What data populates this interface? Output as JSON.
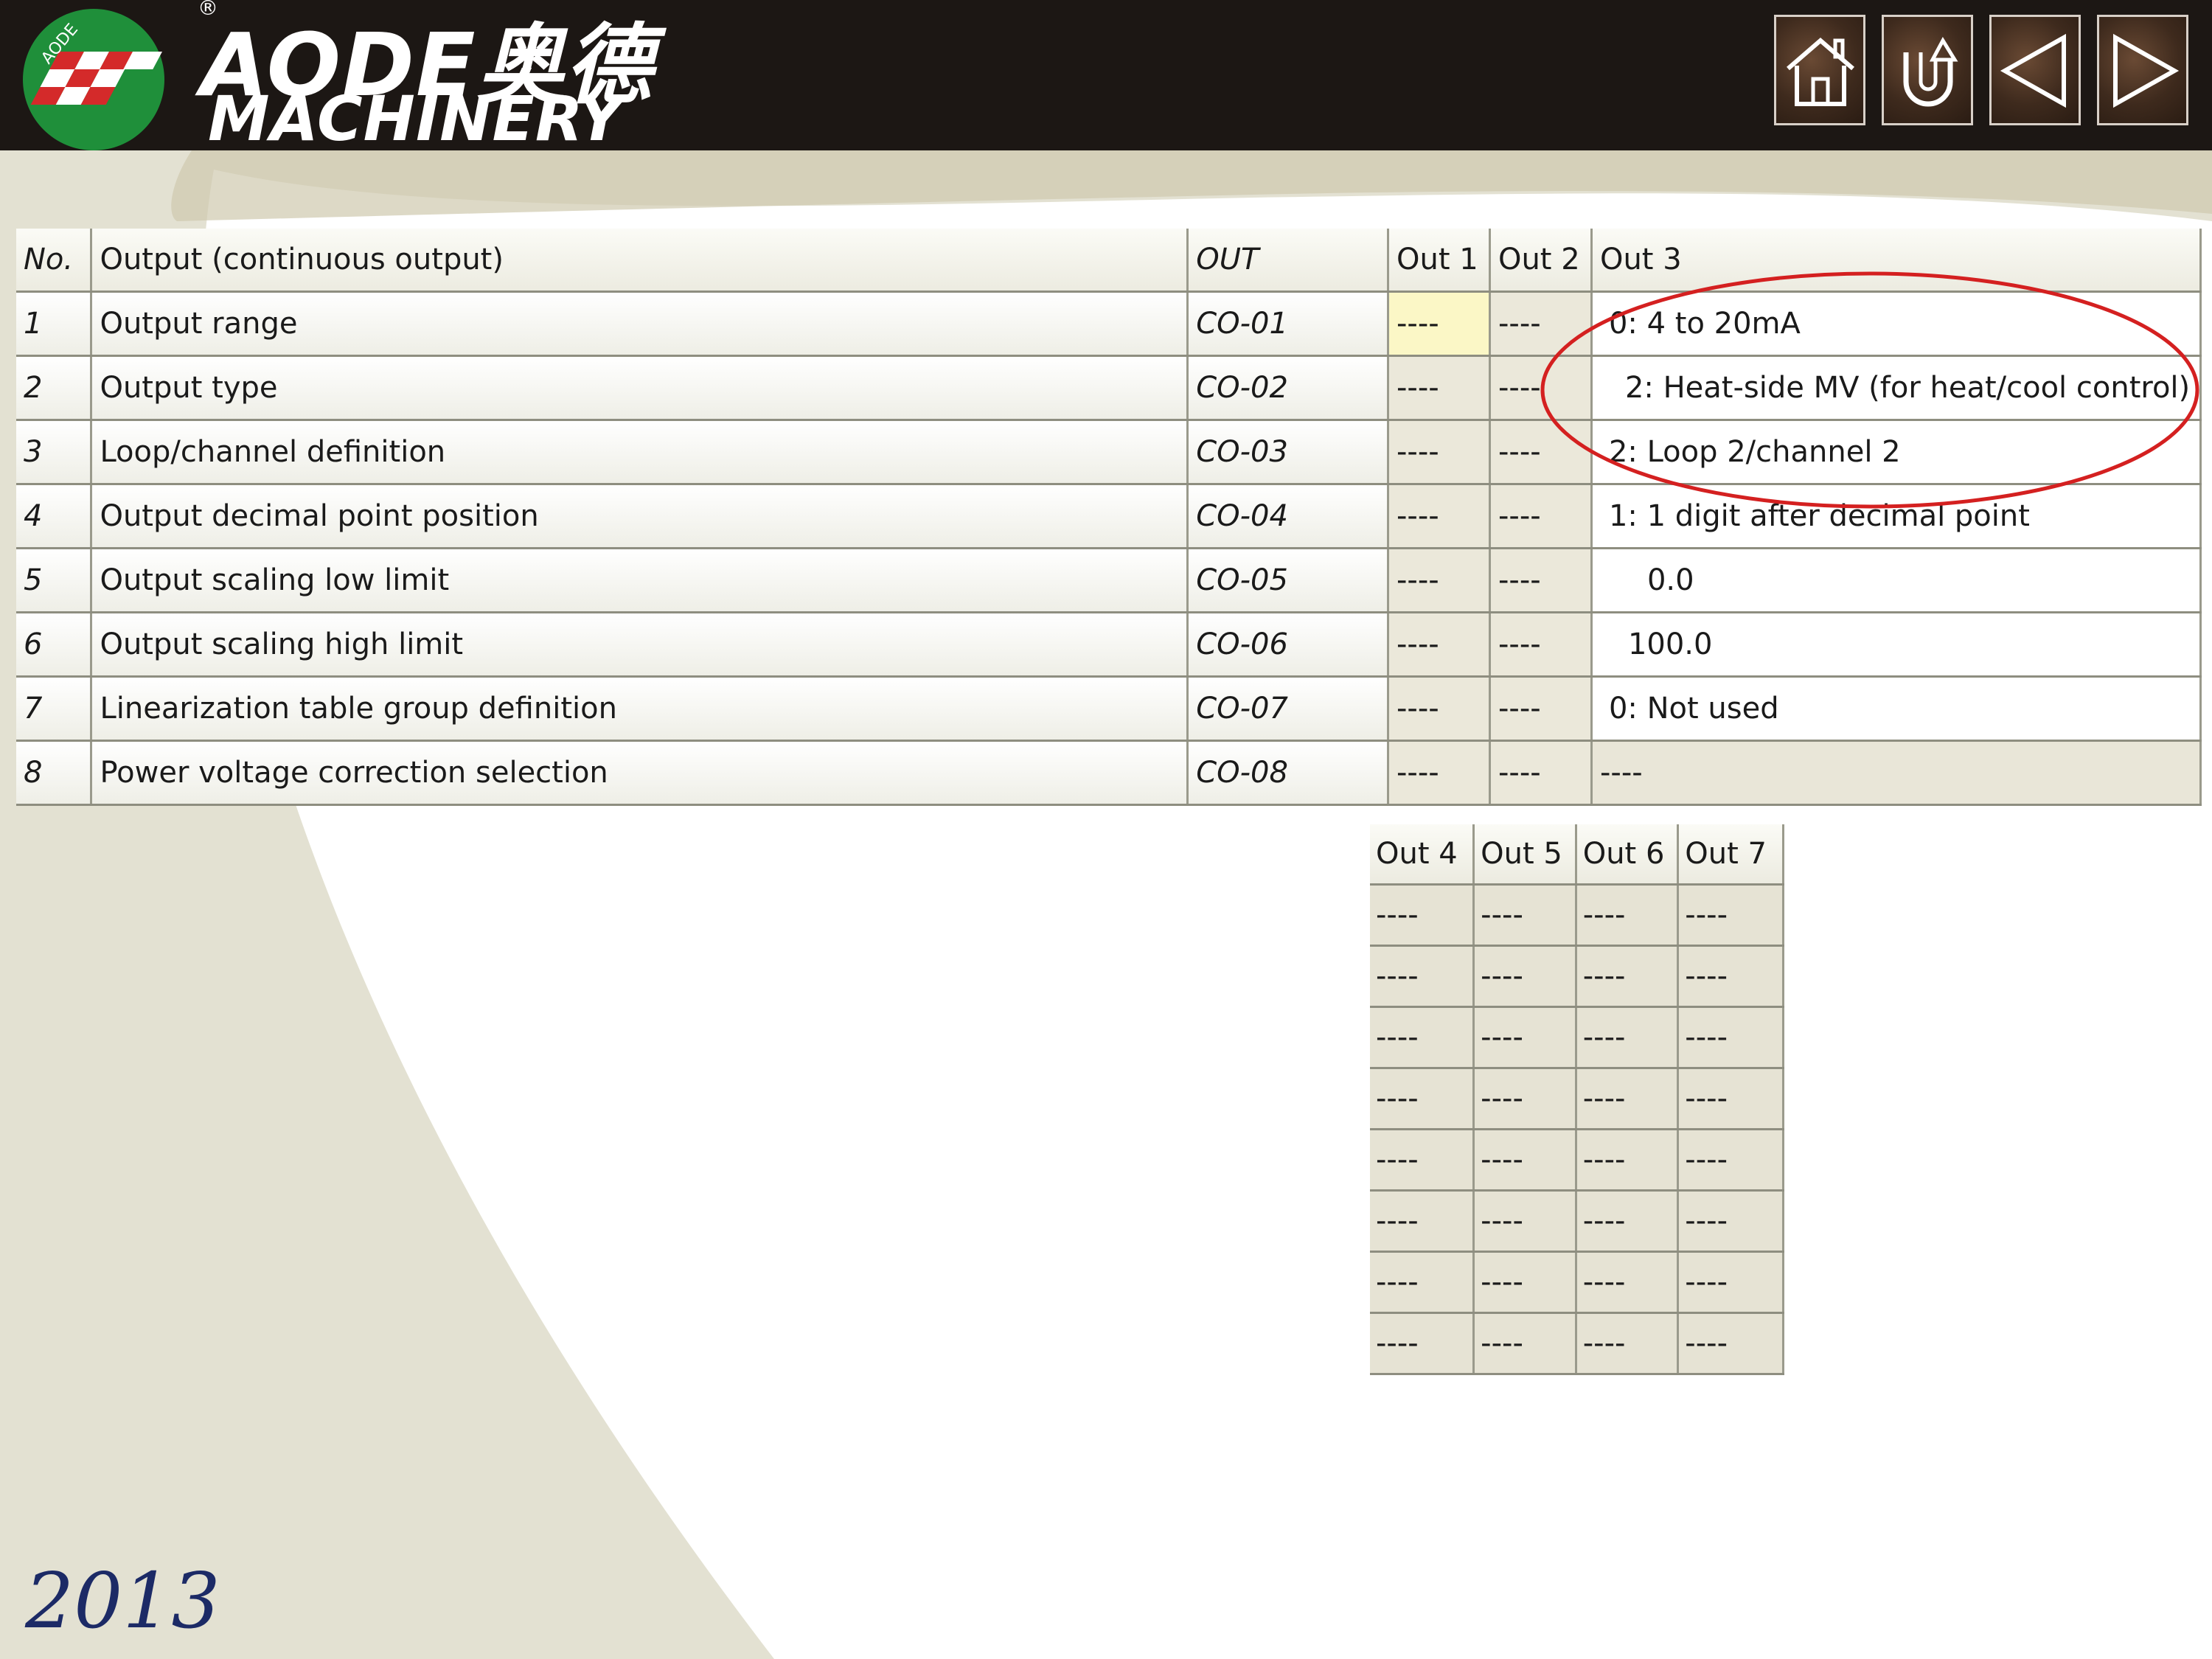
{
  "header": {
    "brand_line1": "AODE奥德",
    "brand_line2": "MACHINERY",
    "logo_text": "AODE",
    "registered_mark": "®"
  },
  "nav": {
    "home_icon": "home-icon",
    "back_icon": "return-icon",
    "prev_icon": "prev-arrow-icon",
    "next_icon": "next-arrow-icon"
  },
  "main_table": {
    "headers": [
      "No.",
      "Output (continuous output)",
      "OUT",
      "Out 1",
      "Out 2",
      "Out 3"
    ],
    "rows": [
      {
        "no": "1",
        "name": "Output range",
        "code": "CO-01",
        "out1": "----",
        "out2": "----",
        "out3": "0: 4 to 20mA"
      },
      {
        "no": "2",
        "name": "Output type",
        "code": "CO-02",
        "out1": "----",
        "out2": "----",
        "out3": "2: Heat-side MV (for heat/cool control)"
      },
      {
        "no": "3",
        "name": "Loop/channel definition",
        "code": "CO-03",
        "out1": "----",
        "out2": "----",
        "out3": "2: Loop 2/channel 2"
      },
      {
        "no": "4",
        "name": "Output decimal point position",
        "code": "CO-04",
        "out1": "----",
        "out2": "----",
        "out3": "1: 1 digit after decimal point"
      },
      {
        "no": "5",
        "name": "Output scaling low limit",
        "code": "CO-05",
        "out1": "----",
        "out2": "----",
        "out3": "0.0"
      },
      {
        "no": "6",
        "name": "Output scaling high limit",
        "code": "CO-06",
        "out1": "----",
        "out2": "----",
        "out3": "100.0"
      },
      {
        "no": "7",
        "name": "Linearization table group definition",
        "code": "CO-07",
        "out1": "----",
        "out2": "----",
        "out3": "0: Not used"
      },
      {
        "no": "8",
        "name": "Power voltage correction selection",
        "code": "CO-08",
        "out1": "----",
        "out2": "----",
        "out3": "----"
      }
    ]
  },
  "sub_table": {
    "headers": [
      "Out 4",
      "Out 5",
      "Out 6",
      "Out 7"
    ],
    "rows": [
      [
        "----",
        "----",
        "----",
        "----"
      ],
      [
        "----",
        "----",
        "----",
        "----"
      ],
      [
        "----",
        "----",
        "----",
        "----"
      ],
      [
        "----",
        "----",
        "----",
        "----"
      ],
      [
        "----",
        "----",
        "----",
        "----"
      ],
      [
        "----",
        "----",
        "----",
        "----"
      ],
      [
        "----",
        "----",
        "----",
        "----"
      ],
      [
        "----",
        "----",
        "----",
        "----"
      ]
    ]
  },
  "footer": {
    "year": "2013"
  },
  "colors": {
    "header_bg": "#1c1714",
    "swoosh": "#e3e1d2",
    "annotation_circle": "#d42020",
    "year_text": "#1c2a66",
    "logo_green": "#1f8f3a",
    "logo_red": "#d42a2a"
  }
}
